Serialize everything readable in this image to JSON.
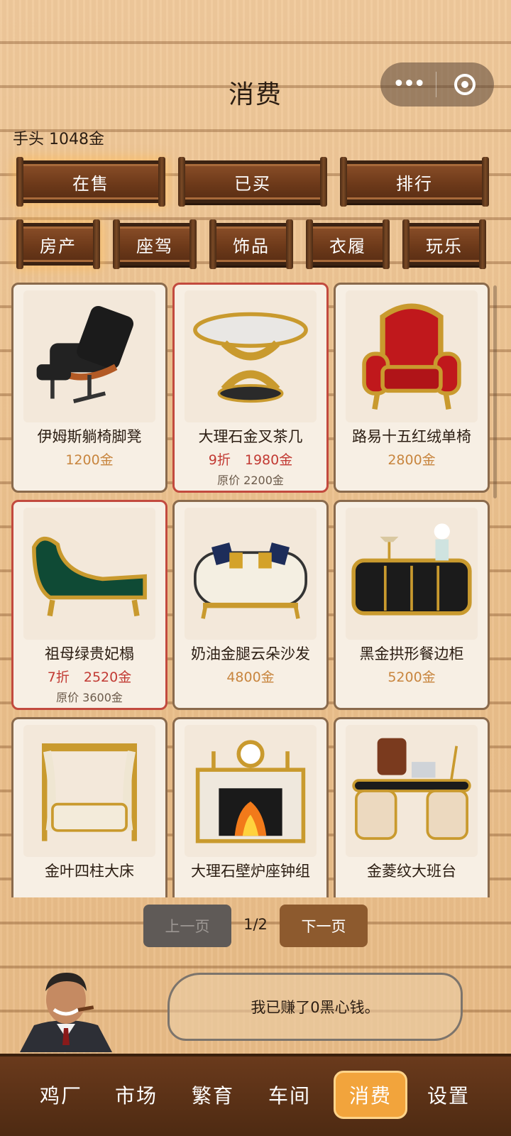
{
  "header": {
    "title": "消费",
    "capsule_more": "•••",
    "balance": "手头 1048金"
  },
  "tabs": [
    {
      "label": "在售",
      "active": true
    },
    {
      "label": "已买",
      "active": false
    },
    {
      "label": "排行",
      "active": false
    }
  ],
  "categories": [
    {
      "label": "房产"
    },
    {
      "label": "座驾"
    },
    {
      "label": "饰品"
    },
    {
      "label": "衣履"
    },
    {
      "label": "玩乐"
    }
  ],
  "items": [
    {
      "name": "伊姆斯躺椅脚凳",
      "price": "1200金",
      "icon": "lounge-chair-icon"
    },
    {
      "name": "大理石金叉茶几",
      "discount": "9折",
      "price": "1980金",
      "original": "原价 2200金",
      "icon": "coffee-table-icon"
    },
    {
      "name": "路易十五红绒单椅",
      "price": "2800金",
      "icon": "armchair-icon"
    },
    {
      "name": "祖母绿贵妃榻",
      "discount": "7折",
      "price": "2520金",
      "original": "原价 3600金",
      "icon": "chaise-icon"
    },
    {
      "name": "奶油金腿云朵沙发",
      "price": "4800金",
      "icon": "sofa-icon"
    },
    {
      "name": "黑金拱形餐边柜",
      "price": "5200金",
      "icon": "sideboard-icon"
    },
    {
      "name": "金叶四柱大床",
      "price": "",
      "icon": "canopy-bed-icon"
    },
    {
      "name": "大理石壁炉座钟组",
      "price": "",
      "icon": "fireplace-icon"
    },
    {
      "name": "金菱纹大班台",
      "price": "",
      "icon": "desk-icon"
    }
  ],
  "pager": {
    "prev": "上一页",
    "page": "1/2",
    "next": "下一页"
  },
  "speech": "我已赚了0黑心钱。",
  "nav": [
    {
      "label": "鸡厂",
      "active": false
    },
    {
      "label": "市场",
      "active": false
    },
    {
      "label": "繁育",
      "active": false
    },
    {
      "label": "车间",
      "active": false
    },
    {
      "label": "消费",
      "active": true
    },
    {
      "label": "设置",
      "active": false
    }
  ],
  "colors": {
    "accent": "#f2a43c",
    "price": "#c8853e",
    "sale": "#c23a33",
    "wood": "#6e3a1a"
  }
}
